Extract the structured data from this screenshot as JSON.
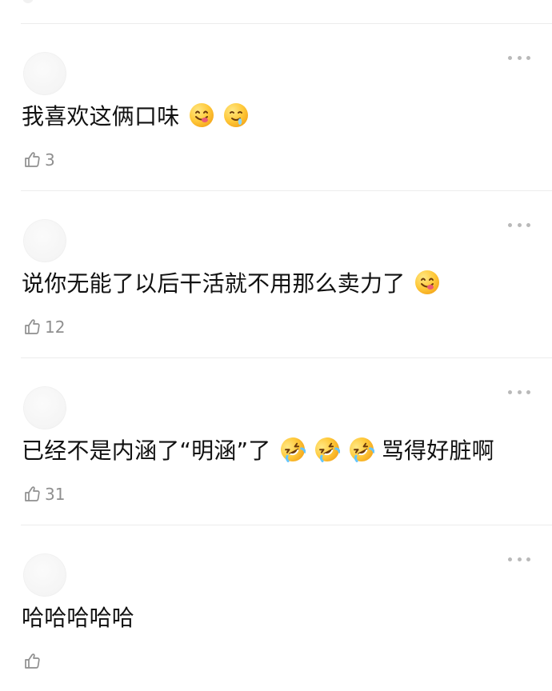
{
  "comments": [
    {
      "text": "我喜欢这俩口味",
      "emojis": [
        "yum-face",
        "drooling-face"
      ],
      "likes": "3"
    },
    {
      "text": "说你无能了以后干活就不用那么卖力了",
      "emojis": [
        "yum-face"
      ],
      "likes": "12"
    },
    {
      "text_prefix": "已经不是内涵了“明涵”了",
      "emojis": [
        "rofl-face",
        "rofl-face",
        "rofl-face"
      ],
      "text_suffix": "骂得好脏啊",
      "likes": "31"
    },
    {
      "text": "哈哈哈哈哈",
      "emojis": [],
      "likes": ""
    }
  ],
  "colors": {
    "text": "#111111",
    "muted": "#8f8f8f",
    "divider": "#ececec",
    "avatar": "#f3f3f3",
    "more_dots": "#b9b9b9"
  }
}
